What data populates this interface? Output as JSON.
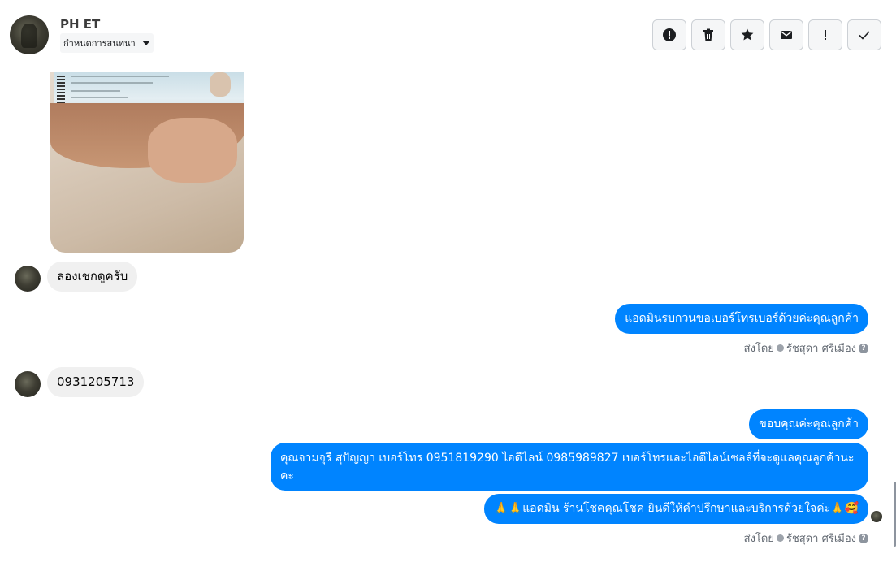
{
  "header": {
    "contact_name": "PH ET",
    "conversation_settings_label": "กำหนดการสนทนา"
  },
  "messages": {
    "incoming_1": "ลองเชกดูครับ",
    "outgoing_1": "แอดมินรบกวนขอเบอร์โทรเบอร์ด้วยค่ะคุณลูกค้า",
    "incoming_2": "0931205713",
    "outgoing_2": "ขอบคุณค่ะคุณลูกค้า",
    "outgoing_3": "คุณจามจุรี สุปัญญา เบอร์โทร 0951819290  ไอดีไลน์ 0985989827     เบอร์โทรและไอดีไลน์เซลล์ที่จะดูแลคุณลูกค้านะคะ",
    "outgoing_4": "🙏🙏แอดมิน ร้านโชคคุณโชค ยินดีให้คำปรึกษาและบริการด้วยใจค่ะ🙏🥰"
  },
  "sent_by": {
    "prefix": "ส่งโดย",
    "name": "รัชสุดา ศรีเมือง"
  },
  "icons": {
    "report": "exclamation-circle-icon",
    "delete": "trash-icon",
    "star": "star-icon",
    "mail": "envelope-icon",
    "important": "exclamation-icon",
    "done": "check-icon"
  },
  "colors": {
    "outgoing_bubble": "#0084ff",
    "incoming_bubble": "#f0f0f0"
  }
}
